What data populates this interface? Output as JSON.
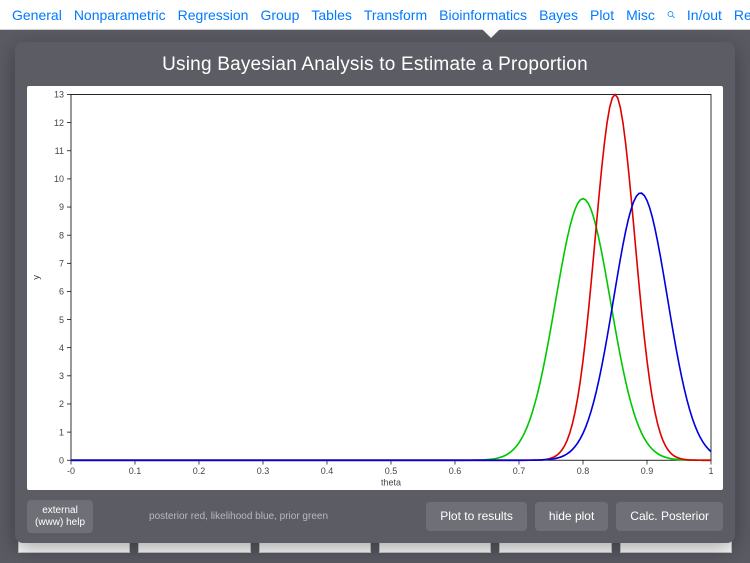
{
  "menu": {
    "items": [
      "General",
      "Nonparametric",
      "Regression",
      "Group",
      "Tables",
      "Transform",
      "Bioinformatics",
      "Bayes",
      "Plot",
      "Misc"
    ],
    "search_icon": "search-icon",
    "in_out": "In/out",
    "results": "Results",
    "info_icon": "info-icon"
  },
  "sheet": {
    "title": "Using Bayesian Analysis to Estimate a Proportion",
    "legend_hint": "posterior red, likelihood blue, prior green",
    "buttons": {
      "help": "external\n(www) help",
      "plot_to_results": "Plot to results",
      "hide_plot": "hide plot",
      "calc_posterior": "Calc. Posterior"
    }
  },
  "chart_data": {
    "type": "line",
    "title": "Using Bayesian Analysis to Estimate a Proportion",
    "xlabel": "theta",
    "ylabel": "y",
    "xlim": [
      -0.0,
      1.0
    ],
    "ylim": [
      0,
      13
    ],
    "xticks": [
      -0.0,
      0.1,
      0.2,
      0.3,
      0.4,
      0.5,
      0.6,
      0.7,
      0.8,
      0.9,
      1.0
    ],
    "yticks": [
      0,
      1,
      2,
      3,
      4,
      5,
      6,
      7,
      8,
      9,
      10,
      11,
      12,
      13
    ],
    "series": [
      {
        "name": "prior",
        "color": "#00c800",
        "mean": 0.8,
        "sd": 0.043,
        "peak": 9.3
      },
      {
        "name": "posterior",
        "color": "#e00000",
        "mean": 0.85,
        "sd": 0.031,
        "peak": 13.0
      },
      {
        "name": "likelihood",
        "color": "#0000e0",
        "mean": 0.89,
        "sd": 0.042,
        "peak": 9.5
      }
    ]
  }
}
